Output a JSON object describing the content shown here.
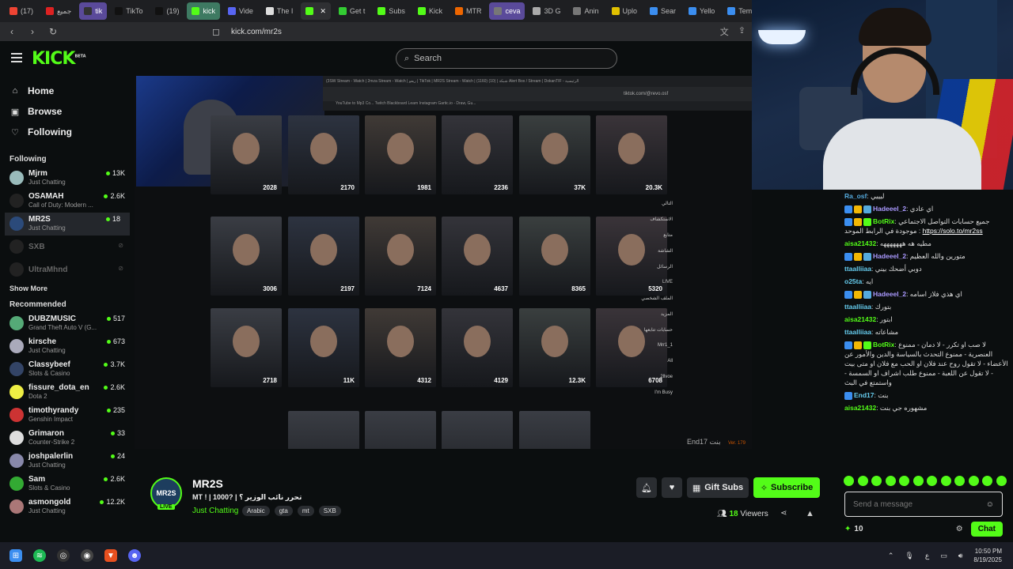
{
  "browser": {
    "tabs": [
      {
        "label": "(17)",
        "color": "#e43",
        "hl": ""
      },
      {
        "label": "جميع",
        "color": "#d22",
        "hl": ""
      },
      {
        "label": "tik",
        "color": "#333",
        "hl": "hl"
      },
      {
        "label": "TikTo",
        "color": "#111",
        "hl": ""
      },
      {
        "label": "(19)",
        "color": "#111",
        "hl": ""
      },
      {
        "label": "kick",
        "color": "#53fc18",
        "hl": "hl2"
      },
      {
        "label": "Vide",
        "color": "#5865f2",
        "hl": ""
      },
      {
        "label": "The I",
        "color": "#ddd",
        "hl": ""
      },
      {
        "label": "",
        "color": "#53fc18",
        "hl": "active"
      },
      {
        "label": "Get t",
        "color": "#3c3",
        "hl": ""
      },
      {
        "label": "Subs",
        "color": "#53fc18",
        "hl": ""
      },
      {
        "label": "Kick",
        "color": "#53fc18",
        "hl": ""
      },
      {
        "label": "MTR",
        "color": "#e60",
        "hl": ""
      },
      {
        "label": "ceva",
        "color": "#777",
        "hl": "hl"
      },
      {
        "label": "3D G",
        "color": "#aaa",
        "hl": ""
      },
      {
        "label": "Anin",
        "color": "#777",
        "hl": ""
      },
      {
        "label": "Uplo",
        "color": "#e0c000",
        "hl": ""
      },
      {
        "label": "Sear",
        "color": "#3b8ef0",
        "hl": ""
      },
      {
        "label": "Yello",
        "color": "#3b8ef0",
        "hl": ""
      },
      {
        "label": "Temp",
        "color": "#3b8ef0",
        "hl": ""
      }
    ],
    "url": "kick.com/mr2s"
  },
  "header": {
    "logo": "KICK",
    "logo_sup": "BETA",
    "search_placeholder": "Search"
  },
  "sidebar": {
    "nav": [
      {
        "label": "Home",
        "icon": "⌂",
        "name": "home"
      },
      {
        "label": "Browse",
        "icon": "▣",
        "name": "browse"
      },
      {
        "label": "Following",
        "icon": "♡",
        "name": "following"
      }
    ],
    "following_title": "Following",
    "following": [
      {
        "name": "Mjrm",
        "category": "Just Chatting",
        "viewers": "13K",
        "color": "#9bb"
      },
      {
        "name": "OSAMAH",
        "category": "Call of Duty: Modern ...",
        "viewers": "2.6K",
        "color": "#222"
      },
      {
        "name": "MR2S",
        "category": "Just Chatting",
        "viewers": "18",
        "color": "#2b4a7a"
      }
    ],
    "offline": [
      {
        "name": "SXB"
      },
      {
        "name": "UltraMhnd"
      }
    ],
    "show_more": "Show More",
    "recommended_title": "Recommended",
    "recommended": [
      {
        "name": "DUBZMUSIC",
        "category": "Grand Theft Auto V (G...",
        "viewers": "517",
        "color": "#5a7"
      },
      {
        "name": "kirsche",
        "category": "Just Chatting",
        "viewers": "673",
        "color": "#aab"
      },
      {
        "name": "Classybeef",
        "category": "Slots & Casino",
        "viewers": "3.7K",
        "color": "#346"
      },
      {
        "name": "fissure_dota_en",
        "category": "Dota 2",
        "viewers": "2.6K",
        "color": "#ee4"
      },
      {
        "name": "timothyrandy",
        "category": "Genshin Impact",
        "viewers": "235",
        "color": "#c33"
      },
      {
        "name": "Grimaron",
        "category": "Counter-Strike 2",
        "viewers": "33",
        "color": "#ddd"
      },
      {
        "name": "joshpalerlin",
        "category": "Just Chatting",
        "viewers": "24",
        "color": "#88a"
      },
      {
        "name": "Sam",
        "category": "Slots & Casino",
        "viewers": "2.6K",
        "color": "#3a3"
      },
      {
        "name": "asmongold",
        "category": "Just Chatting",
        "viewers": "12.2K",
        "color": "#a77"
      }
    ]
  },
  "video": {
    "inner_tabs": "(3SW Stream - Watch  |  2mza Stream - Watch  |  ريفو | TikTok  |  MR2S Stream - Watch  |  (1160) شبكة  |  (10) Alert Box / Stream  |  DokanTIF - الرئيسية",
    "inner_url": "tiktok.com/@revo.osf",
    "inner_bookmarks": "YouTube to Mp3 Co...   Twitch   Blackboard Learn   Instagram   Gartic.io - Draw, Gu...",
    "counts_row0": [
      "2028",
      "2170",
      "1981",
      "2236",
      "37K",
      "20.3K"
    ],
    "counts_row1": [
      "3006",
      "2197",
      "7124",
      "4637",
      "8365",
      "5320"
    ],
    "counts_row2": [
      "2718",
      "11K",
      "4312",
      "4129",
      "12.3K",
      "6708"
    ],
    "side_menu": [
      "التالي",
      "الاستكشاف",
      "متابع",
      "الشاشة",
      "الرسائل",
      "LIVE",
      "الملف الشخصي",
      "المزيد",
      "حسابات تتابعها",
      "Mrr1_1",
      "All",
      "2llvoe",
      "I'm Busy"
    ],
    "overlay_end": "End17",
    "overlay_text": "بنت",
    "version": "Ver. 179"
  },
  "chat": {
    "messages": [
      {
        "user": "Ra_osf",
        "text": "ليييي",
        "color": "#5ad",
        "badges": []
      },
      {
        "user": "Hadeeel_2",
        "text": "اي عادي",
        "color": "#a9f",
        "badges": [
          "#3b8ef0",
          "#f2b705",
          "#5ad"
        ]
      },
      {
        "user": "BotRix",
        "text": "جميع حسابات التواصل الاجتماعي موجودة في الرابط الموحد :",
        "link": "https://solo.to/mr2ss",
        "color": "#53fc18",
        "badges": [
          "#3b8ef0",
          "#f2b705",
          "#53fc18"
        ]
      },
      {
        "user": "aisa21432",
        "text": "مطيه هه هههههههه",
        "color": "#53fc18",
        "badges": []
      },
      {
        "user": "Hadeeel_2",
        "text": "متورين والله العظيم",
        "color": "#a9f",
        "badges": [
          "#3b8ef0",
          "#f2b705",
          "#5ad"
        ]
      },
      {
        "user": "ttaalliiaa",
        "text": "دوبي أضحك بيني",
        "color": "#6ce",
        "badges": []
      },
      {
        "user": "o25ta",
        "text": "ايه",
        "color": "#6ce",
        "badges": []
      },
      {
        "user": "Hadeeel_2",
        "text": "اي هذي فلاز اسامه",
        "color": "#a9f",
        "badges": [
          "#3b8ef0",
          "#f2b705",
          "#5ad"
        ]
      },
      {
        "user": "ttaalliiaa",
        "text": "بتورك",
        "color": "#6ce",
        "badges": []
      },
      {
        "user": "aisa21432",
        "text": "ابتور",
        "color": "#53fc18",
        "badges": []
      },
      {
        "user": "ttaalliiaa",
        "text": "مشاعاته",
        "color": "#6ce",
        "badges": []
      },
      {
        "user": "BotRix",
        "text": "لا صب او تكرر - لا دمان - ممنوع العنصرية - ممنوع التحدث بالسياسة والدين والأمور عن الأعضاء - لا تقول روح عند فلان او الحب مع فلان او متى بيت - لا تقول عن اللعبة - ممنوع طلب اشراف او السمسة - واستمتع في البث",
        "color": "#53fc18",
        "badges": [
          "#3b8ef0",
          "#f2b705",
          "#53fc18"
        ]
      },
      {
        "user": "End17",
        "text": "بنت",
        "color": "#6ce",
        "badges": [
          "#3b8ef0"
        ]
      },
      {
        "user": "aisa21432",
        "text": "مشهوره جي بنت",
        "color": "#53fc18",
        "badges": []
      }
    ],
    "input_placeholder": "Send a message",
    "points": "10",
    "send_label": "Chat"
  },
  "stream": {
    "avatar_text": "MR2S",
    "live_label": "LIVE",
    "name": "MR2S",
    "title": "MT ! | 1000? | تحرر نائب الوزير ؟",
    "category": "Just Chatting",
    "tags": [
      "Arabic",
      "gta",
      "mt",
      "SXB"
    ],
    "gift_label": "Gift Subs",
    "subscribe_label": "Subscribe",
    "viewers_count": "18",
    "viewers_label": "Viewers"
  },
  "taskbar": {
    "time": "10:50 PM",
    "date": "8/19/2025",
    "lang": "ع"
  }
}
